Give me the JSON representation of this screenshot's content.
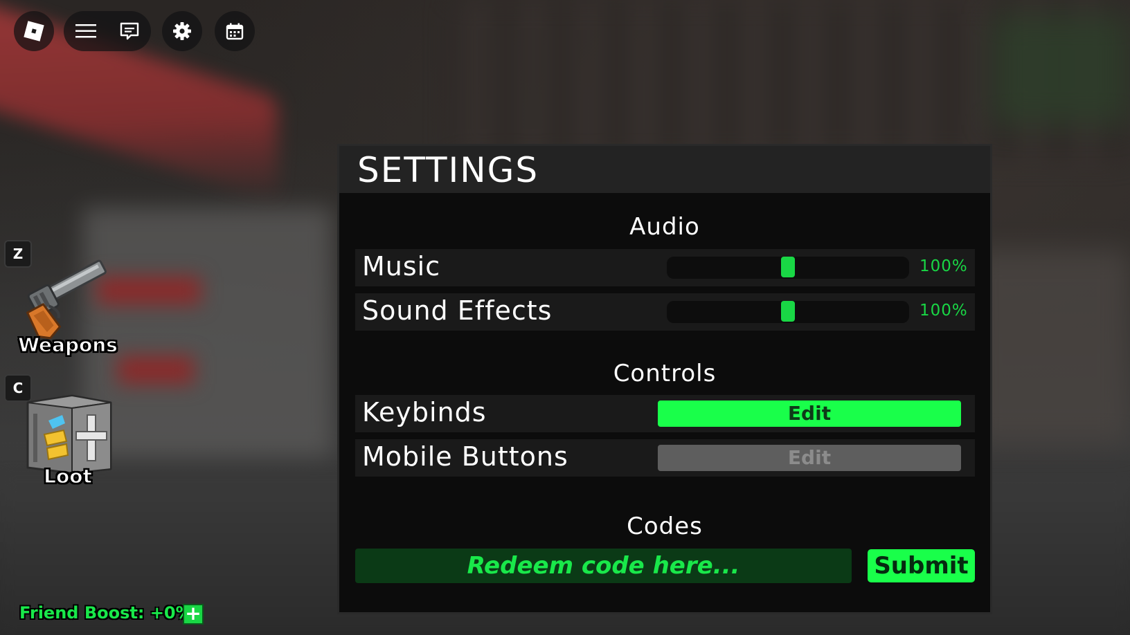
{
  "topbar": {
    "icons": [
      "roblox-logo-icon",
      "menu-icon",
      "chat-icon",
      "settings-gear-icon",
      "calendar-icon"
    ]
  },
  "hotbar": {
    "weapons": {
      "key": "Z",
      "label": "Weapons",
      "icon": "revolver-icon"
    },
    "loot": {
      "key": "C",
      "label": "Loot",
      "icon": "safe-icon"
    }
  },
  "friend_boost": {
    "text": "Friend Boost: +0%",
    "plus_label": "+"
  },
  "settings": {
    "title": "SETTINGS",
    "audio": {
      "heading": "Audio",
      "music": {
        "label": "Music",
        "value_text": "100%",
        "level": 0.5
      },
      "sound_effects": {
        "label": "Sound Effects",
        "value_text": "100%",
        "level": 0.5
      }
    },
    "controls": {
      "heading": "Controls",
      "keybinds": {
        "label": "Keybinds",
        "button": "Edit",
        "enabled": true
      },
      "mobile_buttons": {
        "label": "Mobile Buttons",
        "button": "Edit",
        "enabled": false
      }
    },
    "codes": {
      "heading": "Codes",
      "placeholder": "Redeem code here...",
      "value": "",
      "submit": "Submit"
    }
  },
  "colors": {
    "accent_green": "#19ff4a",
    "text_green": "#19d745",
    "panel_bg": "#0c0c0c",
    "header_bg": "#232323",
    "row_bg": "#1a1a1a",
    "disabled_button": "#5e5e5e"
  }
}
